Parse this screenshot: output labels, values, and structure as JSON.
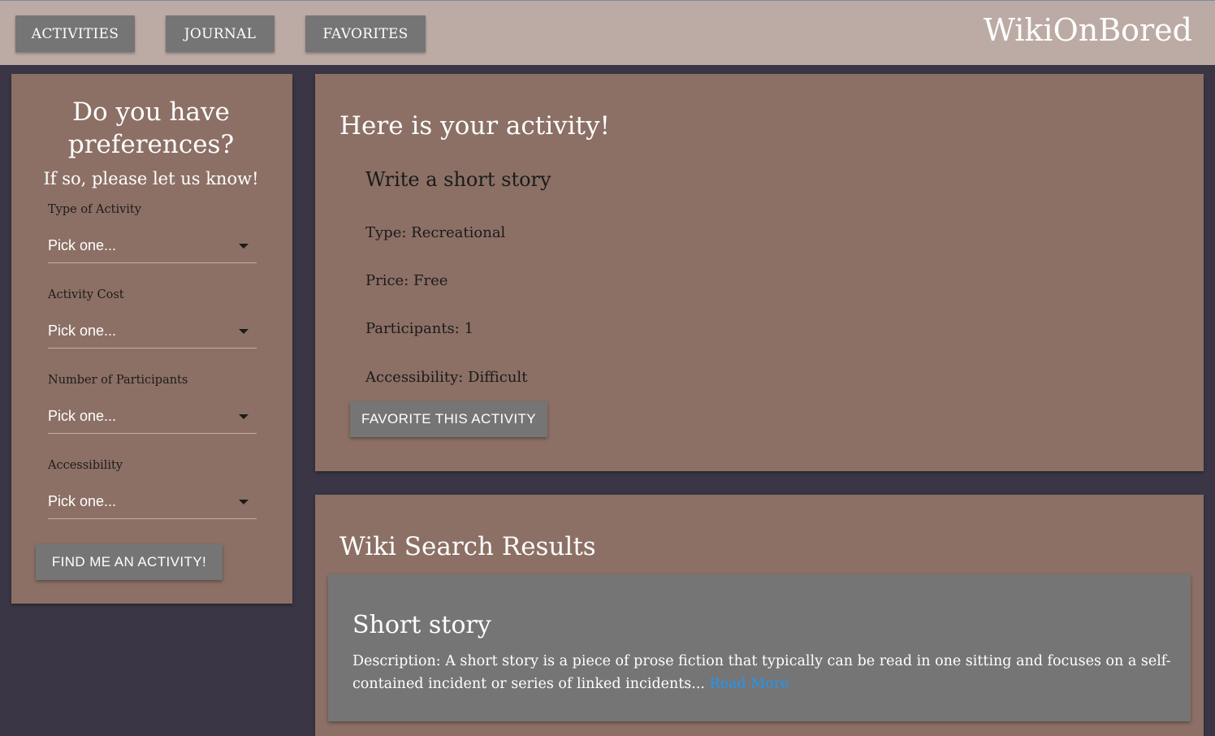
{
  "nav": {
    "activities_label": "ACTIVITIES",
    "journal_label": "JOURNAL",
    "favorites_label": "FAVORITES",
    "brand": "WikiOnBored"
  },
  "preferences": {
    "title": "Do you have preferences?",
    "subtitle": "If so, please let us know!",
    "fields": [
      {
        "label": "Type of Activity",
        "value": "Pick one..."
      },
      {
        "label": "Activity Cost",
        "value": "Pick one..."
      },
      {
        "label": "Number of Participants",
        "value": "Pick one..."
      },
      {
        "label": "Accessibility",
        "value": "Pick one..."
      }
    ],
    "submit_label": "FIND ME AN ACTIVITY!"
  },
  "activity": {
    "heading": "Here is your activity!",
    "name": "Write a short story",
    "type": "Type: Recreational",
    "price": "Price: Free",
    "participants": "Participants: 1",
    "accessibility": "Accessibility: Difficult",
    "favorite_label": "FAVORITE THIS ACTIVITY"
  },
  "wiki": {
    "heading": "Wiki Search Results",
    "results": [
      {
        "title": "Short story",
        "description": "Description: A short story is a piece of prose fiction that typically can be read in one sitting and focuses on a self-contained incident or series of linked incidents...",
        "read_more": "Read More"
      }
    ]
  },
  "colors": {
    "background": "#3a3645",
    "topbar": "#bcaba4",
    "panel": "#8c7065",
    "button": "#757575",
    "link": "#2196f3"
  }
}
